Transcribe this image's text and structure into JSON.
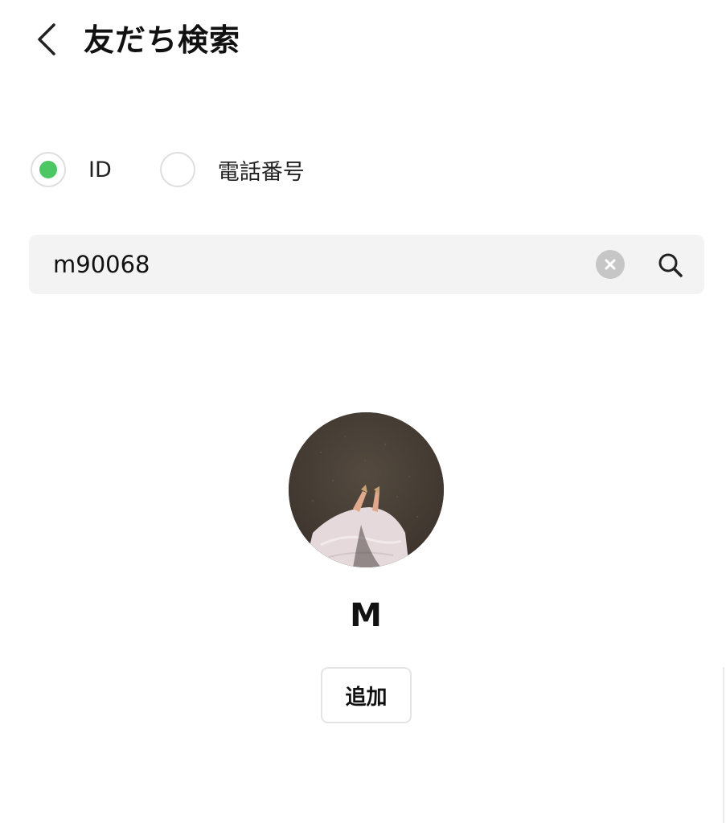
{
  "header": {
    "back_icon": "chevron-left-icon",
    "title": "友だち検索"
  },
  "search_type": {
    "options": [
      {
        "label": "ID",
        "selected": true
      },
      {
        "label": "電話番号",
        "selected": false
      }
    ],
    "accent_color": "#4cc764"
  },
  "search": {
    "value": "m90068",
    "clear_icon": "clear-icon",
    "search_icon": "search-icon"
  },
  "profile": {
    "avatar": "profile-photo",
    "name": "M",
    "add_label": "追加"
  }
}
